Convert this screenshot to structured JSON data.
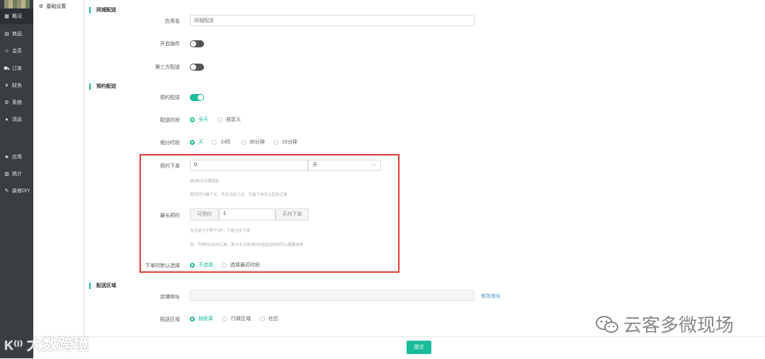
{
  "sidebar": {
    "items": [
      {
        "label": "概况",
        "icon": "dashboard-icon",
        "glyph": "▦"
      },
      {
        "label": "商品",
        "icon": "goods-icon",
        "glyph": "▤"
      },
      {
        "label": "会员",
        "icon": "users-icon",
        "glyph": "☺"
      },
      {
        "label": "订单",
        "icon": "cart-icon",
        "glyph": "⛟"
      },
      {
        "label": "财务",
        "icon": "yen-icon",
        "glyph": "¥"
      },
      {
        "label": "系统",
        "icon": "gears-icon",
        "glyph": "⚙"
      },
      {
        "label": "消息",
        "icon": "chat-icon",
        "glyph": "●"
      },
      {
        "label": "应用",
        "icon": "apps-icon",
        "glyph": "♣"
      },
      {
        "label": "统计",
        "icon": "bar-chart-icon",
        "glyph": "▥"
      },
      {
        "label": "装修DIY",
        "icon": "brush-icon",
        "glyph": "✎"
      }
    ]
  },
  "submenu": {
    "label": "基础设置",
    "icon": "gear-icon"
  },
  "sections": {
    "same_city": "同城配送",
    "reservation": "预约配送",
    "area": "配送区域"
  },
  "form": {
    "app_name": {
      "label": "应用名",
      "placeholder": "同城配送"
    },
    "plugin_toggle": {
      "label": "开启插件",
      "on": false
    },
    "third_party_toggle": {
      "label": "第三方配送",
      "on": false
    },
    "reserve_toggle": {
      "label": "预约配送",
      "on": true
    },
    "delivery_period": {
      "label": "配送时段",
      "options": [
        "全天",
        "自定义"
      ],
      "selected": 0
    },
    "granularity": {
      "label": "细分时段",
      "options": [
        "天",
        "小时",
        "30分钟",
        "15分钟"
      ],
      "selected": 0
    },
    "reserve_order": {
      "label": "预约下单",
      "value": "0",
      "unit_select": "天",
      "help1": "填0时为无需提前",
      "help2": "按天时为每个天，不论当前几点，只能下单天以后的订单"
    },
    "max_reserve": {
      "label": "最长预约",
      "prefix": "可预约",
      "value": "1",
      "suffix": "天内下单",
      "help1": "当天前小于等于1时，只能当天下单",
      "help2": "如：可预约3天内订单，那今天当来8时的话这边时间可以需要选择"
    },
    "default_select": {
      "label": "下单时默认选择",
      "options": [
        "不选择",
        "选择最近时段"
      ],
      "selected": 0
    },
    "store_address": {
      "label": "店铺地址",
      "value": "",
      "link": "修改地址"
    },
    "delivery_area": {
      "label": "配送区域",
      "options": [
        "按距离",
        "行政区域",
        "社区"
      ],
      "selected": 0
    }
  },
  "footer": {
    "submit_label": "提交"
  },
  "watermarks": {
    "left": "大数跨境",
    "right": "云客多微现场"
  },
  "colors": {
    "accent": "#1bbc9b",
    "highlight_box": "#e03c31",
    "sidebar": "#3a3d42"
  }
}
